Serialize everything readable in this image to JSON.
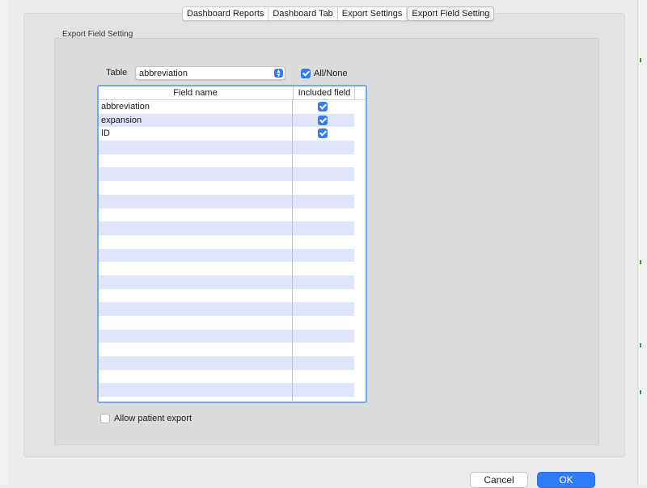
{
  "tabs": [
    {
      "label": "Dashboard Reports",
      "active": false
    },
    {
      "label": "Dashboard Tab",
      "active": false
    },
    {
      "label": "Export Settings",
      "active": false
    },
    {
      "label": "Export Field Setting",
      "active": true
    }
  ],
  "group": {
    "title": "Export Field Setting"
  },
  "table_picker": {
    "label": "Table",
    "value": "abbreviation"
  },
  "all_none": {
    "label": "All/None",
    "checked": true
  },
  "field_list": {
    "columns": [
      "Field name",
      "Included field"
    ],
    "rows": [
      {
        "name": "abbreviation",
        "included": true
      },
      {
        "name": "expansion",
        "included": true
      },
      {
        "name": "ID",
        "included": true
      }
    ]
  },
  "allow_patient_export": {
    "label": "Allow patient export",
    "checked": false
  },
  "buttons": {
    "cancel": "Cancel",
    "ok": "OK"
  },
  "colors": {
    "accent": "#2f7cf6",
    "stripe": "#dfe5fb",
    "list_focus": "#72a6f0"
  }
}
